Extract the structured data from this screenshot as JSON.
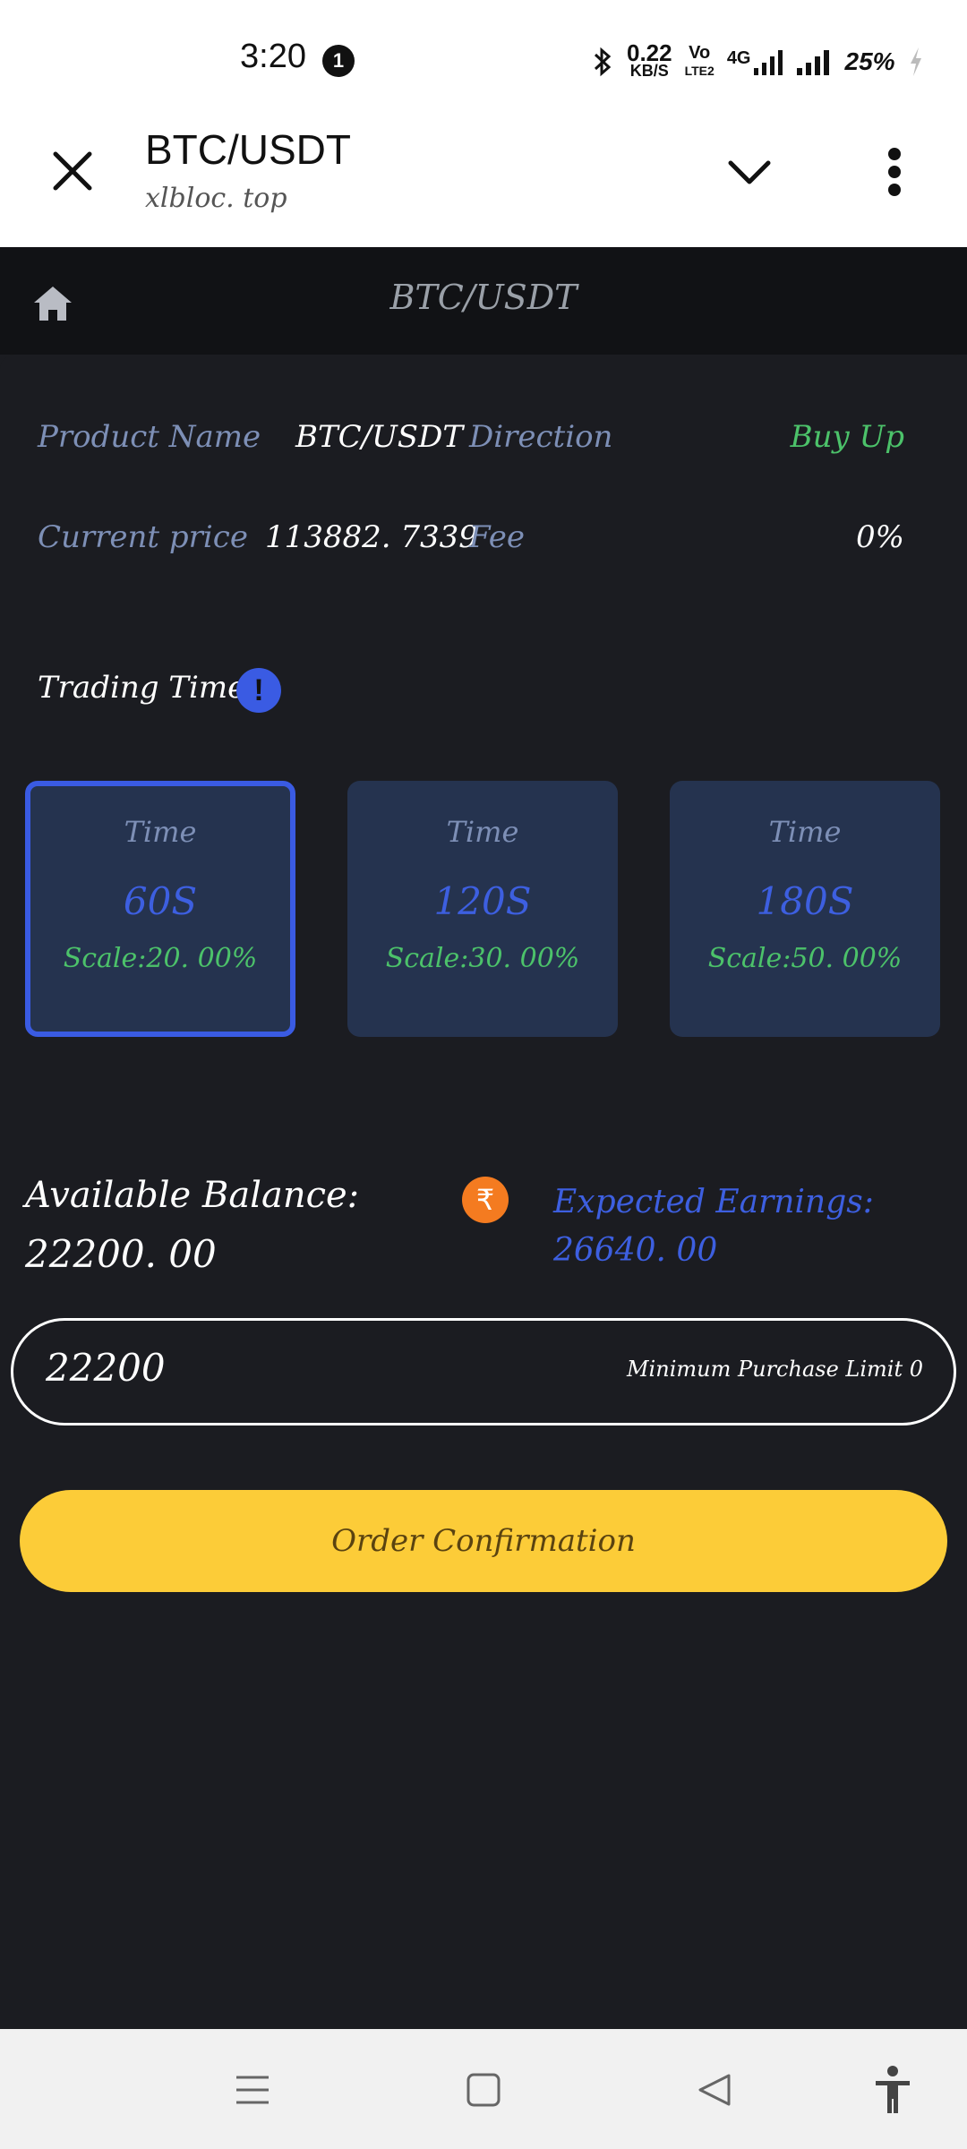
{
  "status_bar": {
    "time": "3:20",
    "notification_count": "1",
    "net_speed_value": "0.22",
    "net_speed_unit": "KB/S",
    "volte_top": "Vo",
    "volte_bottom": "LTE2",
    "network": "4G",
    "battery": "25%"
  },
  "browser": {
    "title": "BTC/USDT",
    "url": "xlbloc. top"
  },
  "app_header": {
    "title": "BTC/USDT"
  },
  "info": {
    "product_name_label": "Product Name",
    "product_name_value": "BTC/USDT",
    "direction_label": "Direction",
    "direction_value": "Buy Up",
    "current_price_label": "Current price",
    "current_price_value": "113882. 7339",
    "fee_label": "Fee",
    "fee_value": "0%"
  },
  "trading_time": {
    "label": "Trading Time",
    "options": [
      {
        "time_label": "Time",
        "seconds": "60S",
        "scale": "Scale:20. 00%",
        "selected": true
      },
      {
        "time_label": "Time",
        "seconds": "120S",
        "scale": "Scale:30. 00%",
        "selected": false
      },
      {
        "time_label": "Time",
        "seconds": "180S",
        "scale": "Scale:50. 00%",
        "selected": false
      }
    ]
  },
  "balance": {
    "available_label": "Available Balance:",
    "available_value": "22200. 00",
    "currency_symbol": "₹",
    "expected_label": "Expected Earnings:",
    "expected_value": "26640. 00"
  },
  "amount_input": {
    "value": "22200",
    "hint": "Minimum Purchase Limit 0"
  },
  "order_button": {
    "label": "Order Confirmation"
  },
  "colors": {
    "accent_blue": "#3d5fe0",
    "green": "#4cc26a",
    "button_yellow": "#fccc38",
    "card_bg": "#25334f"
  }
}
